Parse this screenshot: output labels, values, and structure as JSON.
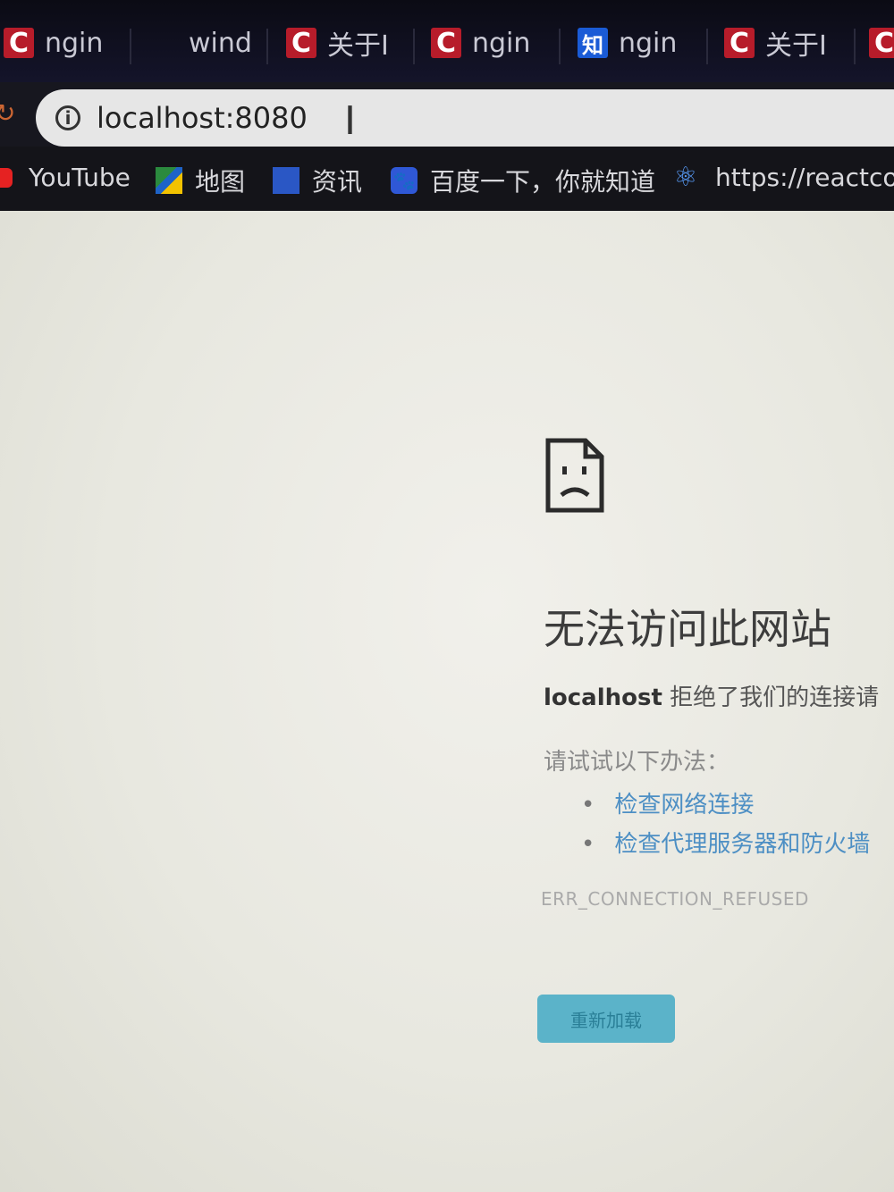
{
  "tabs": [
    {
      "icon": "csdn-c-icon",
      "glyph": "C",
      "label": "ngin"
    },
    {
      "icon": "blank-favicon",
      "glyph": "",
      "label": "wind"
    },
    {
      "icon": "csdn-c-icon",
      "glyph": "C",
      "label": "关于I"
    },
    {
      "icon": "csdn-c-icon",
      "glyph": "C",
      "label": "ngin"
    },
    {
      "icon": "zhihu-icon",
      "glyph": "知",
      "label": "ngin"
    },
    {
      "icon": "csdn-c-icon",
      "glyph": "C",
      "label": "关于I"
    },
    {
      "icon": "csdn-c-icon",
      "glyph": "C",
      "label": ""
    }
  ],
  "address_bar": {
    "url": "localhost:8080",
    "info_glyph": "i"
  },
  "bookmarks": [
    {
      "icon": "youtube-icon",
      "label": "YouTube"
    },
    {
      "icon": "maps-icon",
      "label": "地图"
    },
    {
      "icon": "news-icon",
      "label": "资讯"
    },
    {
      "icon": "baidu-icon",
      "label": "百度一下，你就知道"
    },
    {
      "icon": "react-icon",
      "label": "https://reactcom"
    }
  ],
  "error_page": {
    "title": "无法访问此网站",
    "host": "localhost",
    "message": " 拒绝了我们的连接请",
    "try_heading": "请试试以下办法：",
    "suggestions": [
      "检查网络连接",
      "检查代理服务器和防火墙"
    ],
    "error_code": "ERR_CONNECTION_REFUSED",
    "reload_label": "重新加载"
  },
  "colors": {
    "csdn_red": "#b71c2a",
    "zhihu_blue": "#1a5bd6",
    "link_blue": "#4d8fc4",
    "reload_button": "#5bb3c9"
  }
}
